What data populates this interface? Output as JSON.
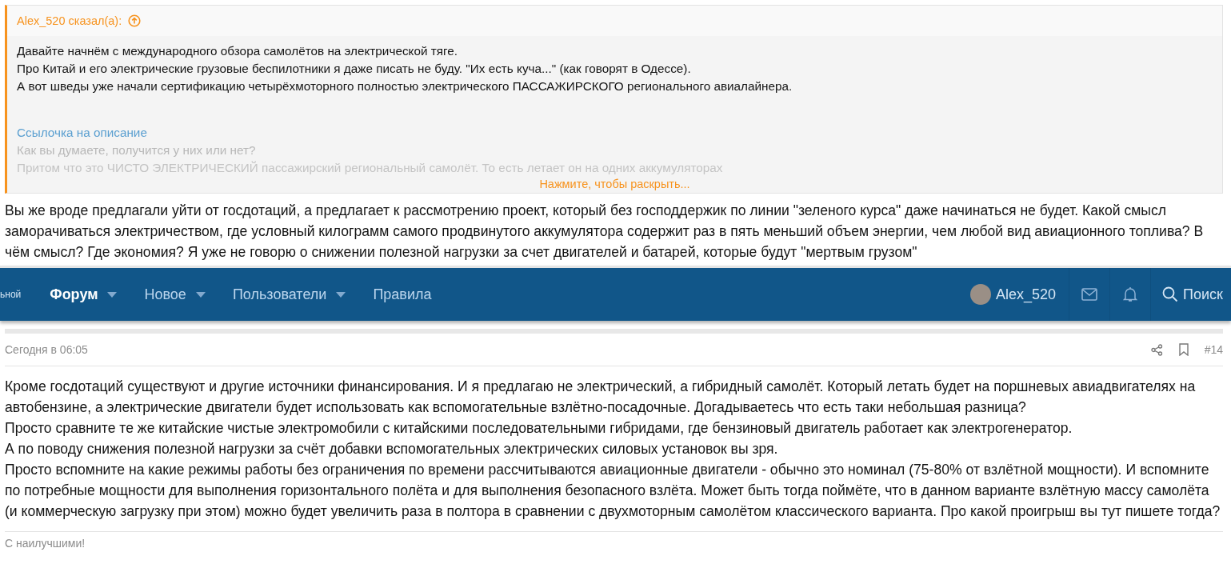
{
  "quote": {
    "author_line": "Alex_520 сказал(а):",
    "lines": [
      "Давайте начнём с международного обзора самолётов на электрической тяге.",
      "Про Китай и его электрические грузовые беспилотники я даже писать не буду. \"Их есть куча...\" (как говорят в Одессе).",
      "А вот шведы уже начали сертификацию четырёхмоторного полностью электрического ПАССАЖИРСКОГО регионального авиалайнера."
    ],
    "link": "Ссылочка на описание",
    "faded_lines": [
      "Как вы думаете, получится у них или нет?",
      "Притом что это ЧИСТО ЭЛЕКТРИЧЕСКИЙ пассажирский региональный самолёт. То есть летает он на одних аккумуляторах"
    ],
    "expand": "Нажмите, чтобы раскрыть..."
  },
  "reply_text": "Вы же вроде предлагали уйти от госдотаций, а предлагает к рассмотрению проект, который без господдержик по линии \"зеленого курса\" даже начинаться не будет. Какой смысл заморачиваться электричеством, где условный килограмм самого продвинутого аккумулятора содержит раз в пять меньший объем энергии, чем любой вид авиационного топлива? В чём смысл? Где экономия? Я уже не говорю о снижении полезной нагрузки за счет двигателей и батарей, которые будут \"мертвым грузом\"",
  "navbar": {
    "cut_label": "ьной",
    "items": [
      {
        "label": "Форум",
        "selected": true,
        "dropdown": true
      },
      {
        "label": "Новое",
        "selected": false,
        "dropdown": true
      },
      {
        "label": "Пользователи",
        "selected": false,
        "dropdown": true
      },
      {
        "label": "Правила",
        "selected": false,
        "dropdown": false
      }
    ],
    "user": "Alex_520",
    "search": "Поиск"
  },
  "post": {
    "time": "Сегодня в 06:05",
    "number": "#14",
    "paragraphs": [
      "Кроме госдотаций существуют и другие источники финансирования. И я предлагаю не электрический, а гибридный самолёт. Который летать будет на поршневых авиадвигателях на автобензине, а электрические двигатели будет использовать как вспомогательные взлётно-посадочные. Догадываетесь что есть таки небольшая разница?",
      "Просто сравните те же китайские чистые электромобили с китайскими последовательными гибридами, где бензиновый двигатель работает как электрогенератор.",
      "А по поводу снижения полезной нагрузки за счёт добавки вспомогательных электрических силовых установок вы зря.",
      "Просто вспомните на какие режимы работы без ограничения по времени рассчитываются авиационные двигатели - обычно это номинал (75-80% от взлётной мощности). И вспомните по потребные мощности для выполнения горизонтального полёта и для выполнения безопасного взлёта. Может быть тогда поймёте, что в данном варианте взлётную массу самолёта (и коммерческую загрузку при этом) можно будет увеличить раза в полтора в сравнении с двухмоторным самолётом классического варианта. Про какой проигрыш вы тут пишете тогда?"
    ],
    "signature": "С наилучшими!"
  }
}
